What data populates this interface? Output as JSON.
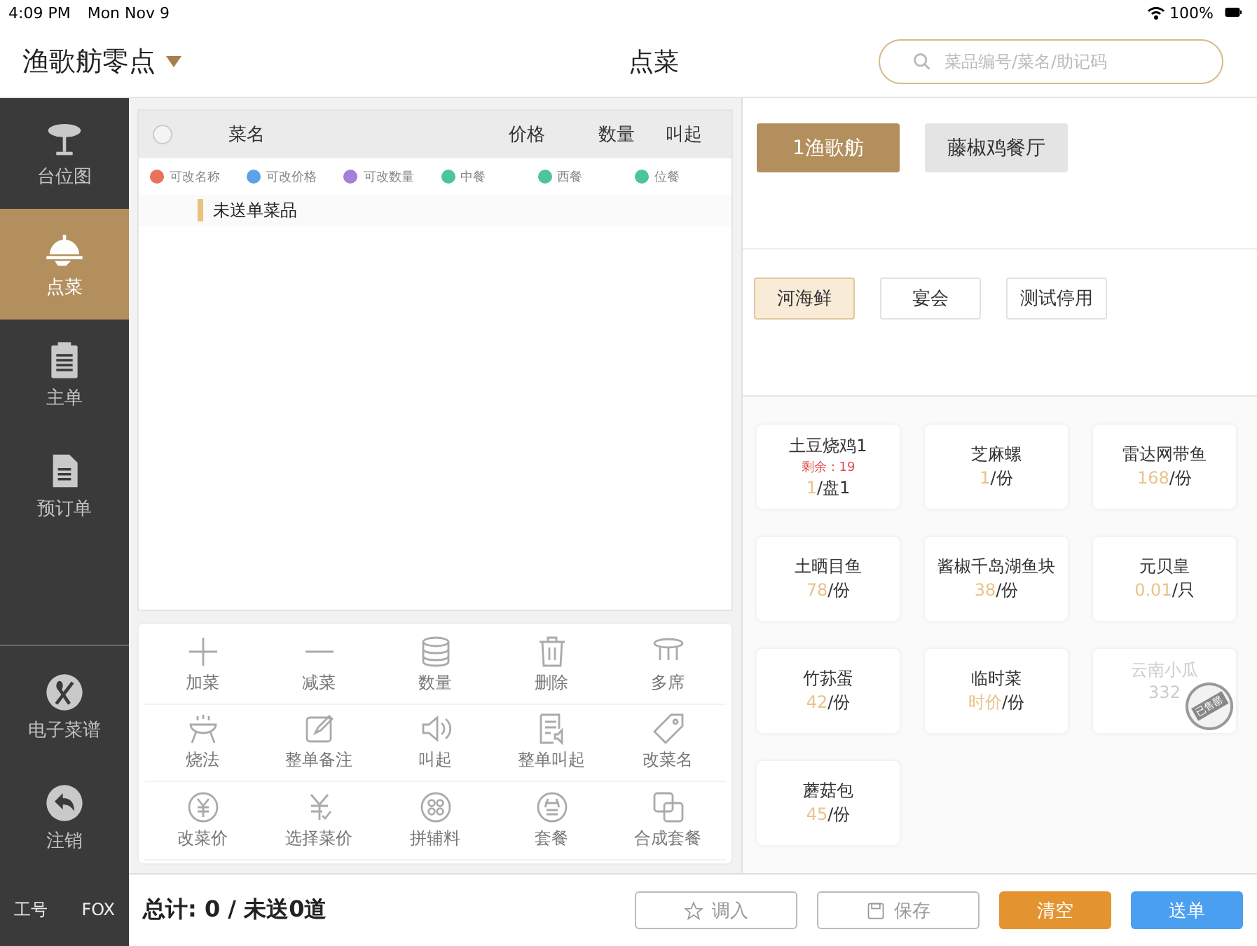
{
  "status_bar": {
    "time": "4:09 PM",
    "date": "Mon Nov 9",
    "battery": "100%"
  },
  "header": {
    "store": "渔歌舫零点",
    "title": "点菜",
    "search": {
      "placeholder": "菜品编号/菜名/助记码"
    }
  },
  "sidebar": {
    "items": [
      {
        "label": "台位图",
        "selected": false
      },
      {
        "label": "点菜",
        "selected": true
      },
      {
        "label": "主单",
        "selected": false
      },
      {
        "label": "预订单",
        "selected": false
      }
    ],
    "bottom_items": [
      {
        "label": "电子菜谱"
      },
      {
        "label": "注销"
      }
    ],
    "footer": {
      "label": "工号",
      "value": "FOX"
    }
  },
  "order_table": {
    "select_all": {
      "checked": false
    },
    "columns": [
      "菜名",
      "价格",
      "数量",
      "叫起"
    ],
    "legend": [
      {
        "label": "可改名称",
        "color": "#e8725a"
      },
      {
        "label": "可改价格",
        "color": "#5ba3e8"
      },
      {
        "label": "可改数量",
        "color": "#a57fd8"
      },
      {
        "label": "中餐",
        "color": "#4cc4a2"
      },
      {
        "label": "西餐",
        "color": "#4cc4a2"
      },
      {
        "label": "位餐",
        "color": "#4cc4a2"
      }
    ],
    "group": "未送单菜品"
  },
  "actions": [
    "加菜",
    "减菜",
    "数量",
    "删除",
    "多席",
    "烧法",
    "整单备注",
    "叫起",
    "整单叫起",
    "改菜名",
    "改菜价",
    "选择菜价",
    "拼辅料",
    "套餐",
    "合成套餐"
  ],
  "total": "总计: 0 / 未送0道",
  "footer_buttons": [
    {
      "label": "调入",
      "kind": "import"
    },
    {
      "label": "保存",
      "kind": "save"
    },
    {
      "label": "清空",
      "kind": "clear"
    },
    {
      "label": "送单",
      "kind": "send"
    }
  ],
  "restaurants": [
    {
      "label": "1渔歌舫",
      "selected": true
    },
    {
      "label": "藤椒鸡餐厅",
      "selected": false
    }
  ],
  "categories": [
    {
      "label": "河海鲜",
      "selected": true
    },
    {
      "label": "宴会",
      "selected": false
    },
    {
      "label": "测试停用",
      "selected": false
    }
  ],
  "dishes": [
    {
      "name": "土豆烧鸡1",
      "remaining": "剩余：19",
      "price": "1",
      "unit": "/盘1",
      "sold_out": false
    },
    {
      "name": "芝麻螺",
      "price": "1",
      "unit": "/份",
      "sold_out": false
    },
    {
      "name": "雷达网带鱼",
      "price": "168",
      "unit": "/份",
      "sold_out": false
    },
    {
      "name": "土晒目鱼",
      "price": "78",
      "unit": "/份",
      "sold_out": false
    },
    {
      "name": "酱椒千岛湖鱼块",
      "price": "38",
      "unit": "/份",
      "sold_out": false
    },
    {
      "name": "元贝皇",
      "price": "0.01",
      "unit": "/只",
      "sold_out": false
    },
    {
      "name": "竹荪蛋",
      "price": "42",
      "unit": "/份",
      "sold_out": false
    },
    {
      "name": "临时菜",
      "price": "时价",
      "unit": "/份",
      "sold_out": false
    },
    {
      "name": "云南小瓜",
      "price": "332",
      "sold_out": true,
      "stamp": "已售罄"
    },
    {
      "name": "蘑菇包",
      "price": "45",
      "unit": "/份",
      "sold_out": false
    }
  ]
}
